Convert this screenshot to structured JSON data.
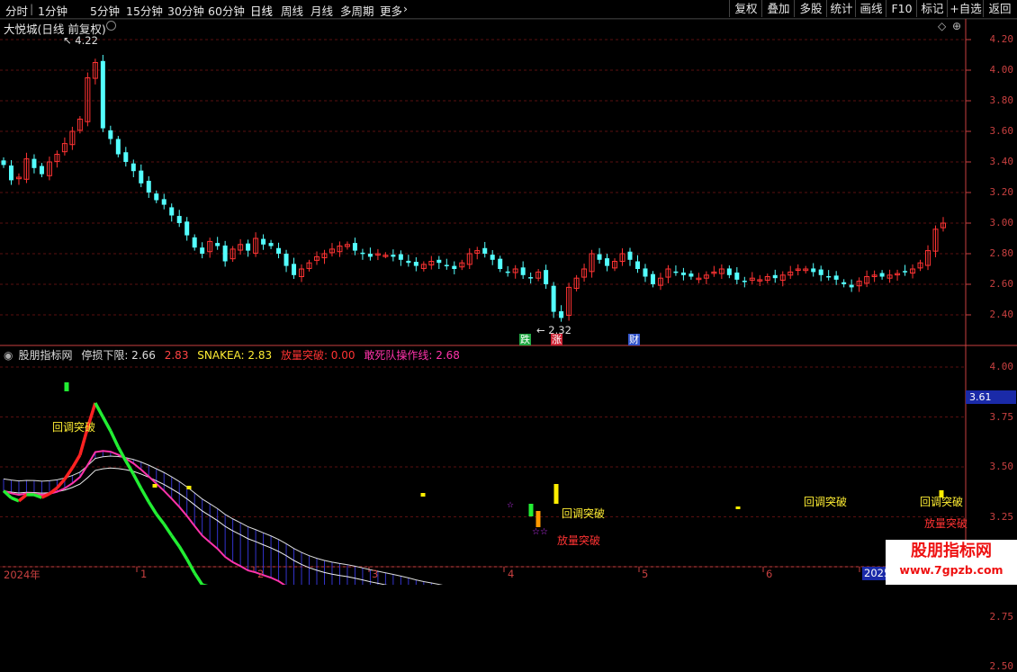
{
  "toolbar": {
    "periods": [
      "分时",
      "1分钟",
      "5分钟",
      "15分钟",
      "30分钟",
      "60分钟",
      "日线",
      "周线",
      "月线",
      "多周期",
      "更多"
    ],
    "active_period": "日线",
    "buttons": [
      "复权",
      "叠加",
      "多股",
      "统计",
      "画线",
      "F10",
      "标记",
      "+自选",
      "返回"
    ]
  },
  "chart_title": "大悦城(日线 前复权)",
  "price_axis": [
    "4.20",
    "4.00",
    "3.80",
    "3.60",
    "3.40",
    "3.20",
    "3.00",
    "2.80",
    "2.60",
    "2.40"
  ],
  "high_label": "4.22",
  "low_label": "2.32",
  "event_marks": [
    {
      "text": "跌",
      "color": "#22aa44"
    },
    {
      "text": "涨",
      "color": "#cc2233"
    },
    {
      "text": "财",
      "color": "#3355cc"
    }
  ],
  "indicator": {
    "name": "股朋指标网",
    "stop_loss": "停损下限: 2.66",
    "value2": "2.83",
    "snakea": "SNAKEA: 2.83",
    "breakout": "放量突破: 0.00",
    "dare": "敢死队操作线: 2.68",
    "axis": [
      "4.00",
      "3.75",
      "3.50",
      "3.25",
      "3.00",
      "2.75",
      "2.50"
    ],
    "current": "3.61"
  },
  "annotations": {
    "pullback": "回调突破",
    "volume_breakout": "放量突破"
  },
  "date_axis": {
    "start": "2024年",
    "months": [
      "1",
      "2",
      "3",
      "4",
      "5",
      "6"
    ],
    "year2025": "2025"
  },
  "watermark": {
    "title": "股朋指标网",
    "url": "www.7gpzb.com"
  },
  "colors": {
    "up": "#ff3333",
    "down": "#54ffff",
    "axis": "#c84040",
    "grid": "#5a1010"
  },
  "chart_data": {
    "type": "candlestick",
    "title": "大悦城(日线 前复权)",
    "ylim": [
      2.3,
      4.3
    ],
    "high": 4.22,
    "low": 2.32,
    "closes": [
      3.38,
      3.28,
      3.3,
      3.42,
      3.36,
      3.32,
      3.4,
      3.45,
      3.52,
      3.6,
      3.68,
      3.95,
      4.05,
      3.62,
      3.55,
      3.45,
      3.4,
      3.34,
      3.26,
      3.2,
      3.15,
      3.12,
      3.05,
      3.0,
      2.92,
      2.84,
      2.8,
      2.88,
      2.85,
      2.75,
      2.83,
      2.86,
      2.82,
      2.9,
      2.86,
      2.85,
      2.8,
      2.72,
      2.66,
      2.7,
      2.74,
      2.78,
      2.8,
      2.83,
      2.85,
      2.86,
      2.82,
      2.8,
      2.78,
      2.8,
      2.79,
      2.78,
      2.76,
      2.74,
      2.72,
      2.73,
      2.75,
      2.74,
      2.72,
      2.7,
      2.74,
      2.8,
      2.82,
      2.8,
      2.76,
      2.7,
      2.68,
      2.7,
      2.66,
      2.64,
      2.68,
      2.6,
      2.42,
      2.38,
      2.58,
      2.64,
      2.7,
      2.8,
      2.76,
      2.72,
      2.75,
      2.8,
      2.76,
      2.7,
      2.65,
      2.6,
      2.64,
      2.7,
      2.68,
      2.66,
      2.65,
      2.64,
      2.66,
      2.68,
      2.7,
      2.66,
      2.63,
      2.62,
      2.64,
      2.63,
      2.65,
      2.64,
      2.66,
      2.68,
      2.7,
      2.7,
      2.68,
      2.66,
      2.65,
      2.63,
      2.6,
      2.58,
      2.62,
      2.65,
      2.66,
      2.65,
      2.66,
      2.67,
      2.68,
      2.7,
      2.74,
      2.82,
      2.96,
      3.0
    ]
  }
}
